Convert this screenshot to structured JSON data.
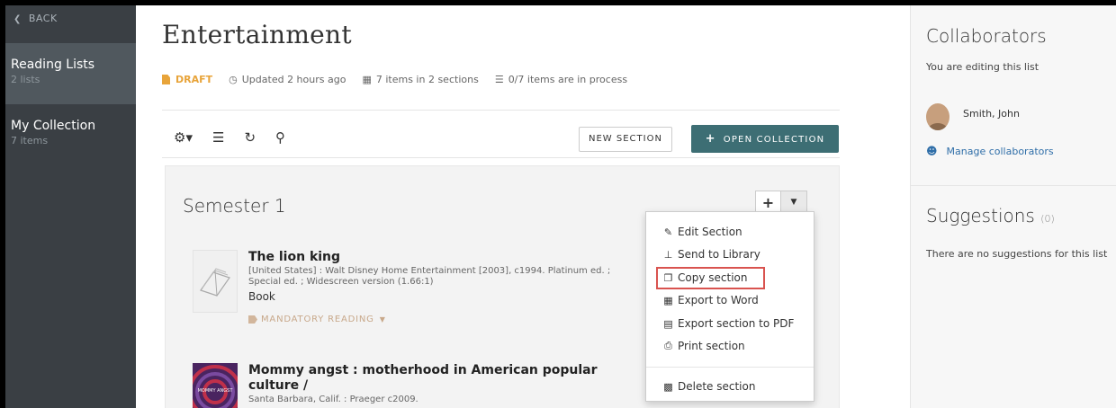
{
  "sidebar": {
    "back_label": "BACK",
    "items": [
      {
        "title": "Reading Lists",
        "subtitle": "2 lists"
      },
      {
        "title": "My Collection",
        "subtitle": "7 items"
      }
    ]
  },
  "main": {
    "title": "Entertainment",
    "status": "DRAFT",
    "updated": "Updated 2 hours ago",
    "items_info": "7 items in 2 sections",
    "process_info": "0/7 items are in process",
    "new_section_label": "NEW SECTION",
    "open_collection_label": "OPEN COLLECTION"
  },
  "section": {
    "title": "Semester 1",
    "items": [
      {
        "title": "The lion king",
        "description": "[United States] : Walt Disney Home Entertainment [2003], c1994. Platinum ed. ; Special ed. ; Widescreen version (1.66:1)",
        "type": "Book",
        "tag": "MANDATORY READING"
      },
      {
        "title": "Mommy angst : motherhood in American popular culture /",
        "description": "Santa Barbara, Calif. : Praeger c2009.",
        "poster_text": "MOMMY ANGST"
      }
    ]
  },
  "dropdown": {
    "items": [
      {
        "label": "Edit Section",
        "icon": "pencil-icon"
      },
      {
        "label": "Send to Library",
        "icon": "pin-icon"
      },
      {
        "label": "Copy section",
        "icon": "copy-icon"
      },
      {
        "label": "Export to Word",
        "icon": "word-icon"
      },
      {
        "label": "Export section to PDF",
        "icon": "pdf-icon"
      },
      {
        "label": "Print section",
        "icon": "print-icon"
      },
      {
        "label": "Delete section",
        "icon": "trash-icon"
      }
    ]
  },
  "right": {
    "collab_title": "Collaborators",
    "editing_text": "You are editing this list",
    "collaborator_name": "Smith, John",
    "manage_label": "Manage collaborators",
    "suggestions_title": "Suggestions",
    "suggestions_count": "(0)",
    "no_suggestions_text": "There are no suggestions for this list"
  },
  "colors": {
    "sidebar": "#3a3f44",
    "accent": "#3d6e74",
    "draft": "#e8a43a",
    "highlight": "#d9534f",
    "link": "#2f6ea8"
  }
}
